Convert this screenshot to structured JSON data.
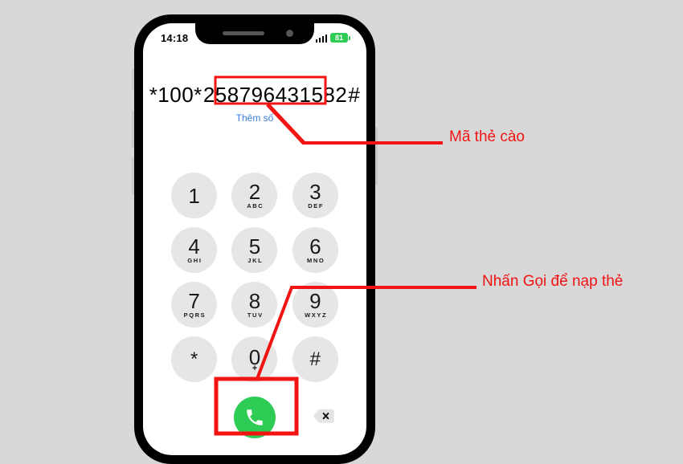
{
  "phone": {
    "status_bar": {
      "time": "14:18",
      "signal_icon": "cellular-signal-icon",
      "battery_level": "81",
      "battery_icon": "battery-icon"
    },
    "dial_display": {
      "prefix": "*100*",
      "code": "258796431582",
      "suffix": "#",
      "full_number": "*100*258796431582#",
      "add_number_label": "Thêm số"
    },
    "keypad": [
      {
        "digit": "1",
        "letters": ""
      },
      {
        "digit": "2",
        "letters": "ABC"
      },
      {
        "digit": "3",
        "letters": "DEF"
      },
      {
        "digit": "4",
        "letters": "GHI"
      },
      {
        "digit": "5",
        "letters": "JKL"
      },
      {
        "digit": "6",
        "letters": "MNO"
      },
      {
        "digit": "7",
        "letters": "PQRS"
      },
      {
        "digit": "8",
        "letters": "TUV"
      },
      {
        "digit": "9",
        "letters": "WXYZ"
      },
      {
        "digit": "*",
        "letters": ""
      },
      {
        "digit": "0",
        "letters": "+"
      },
      {
        "digit": "#",
        "letters": ""
      }
    ],
    "call_button": {
      "icon": "phone-handset-icon",
      "color": "#2ecc55"
    },
    "backspace_button": {
      "icon": "backspace-delete-icon",
      "glyph": "×"
    },
    "hardware": {
      "silent_switch": "silent-switch",
      "volume_up": "volume-up-button",
      "volume_down": "volume-down-button",
      "power": "power-button",
      "notch_speaker": "earpiece-speaker",
      "notch_camera": "front-camera"
    }
  },
  "annotations": {
    "accent_color": "#f21313",
    "code_label": "Mã thẻ cào",
    "call_label": "Nhấn Gọi để nạp thẻ"
  },
  "background_color": "#d8d8d8"
}
